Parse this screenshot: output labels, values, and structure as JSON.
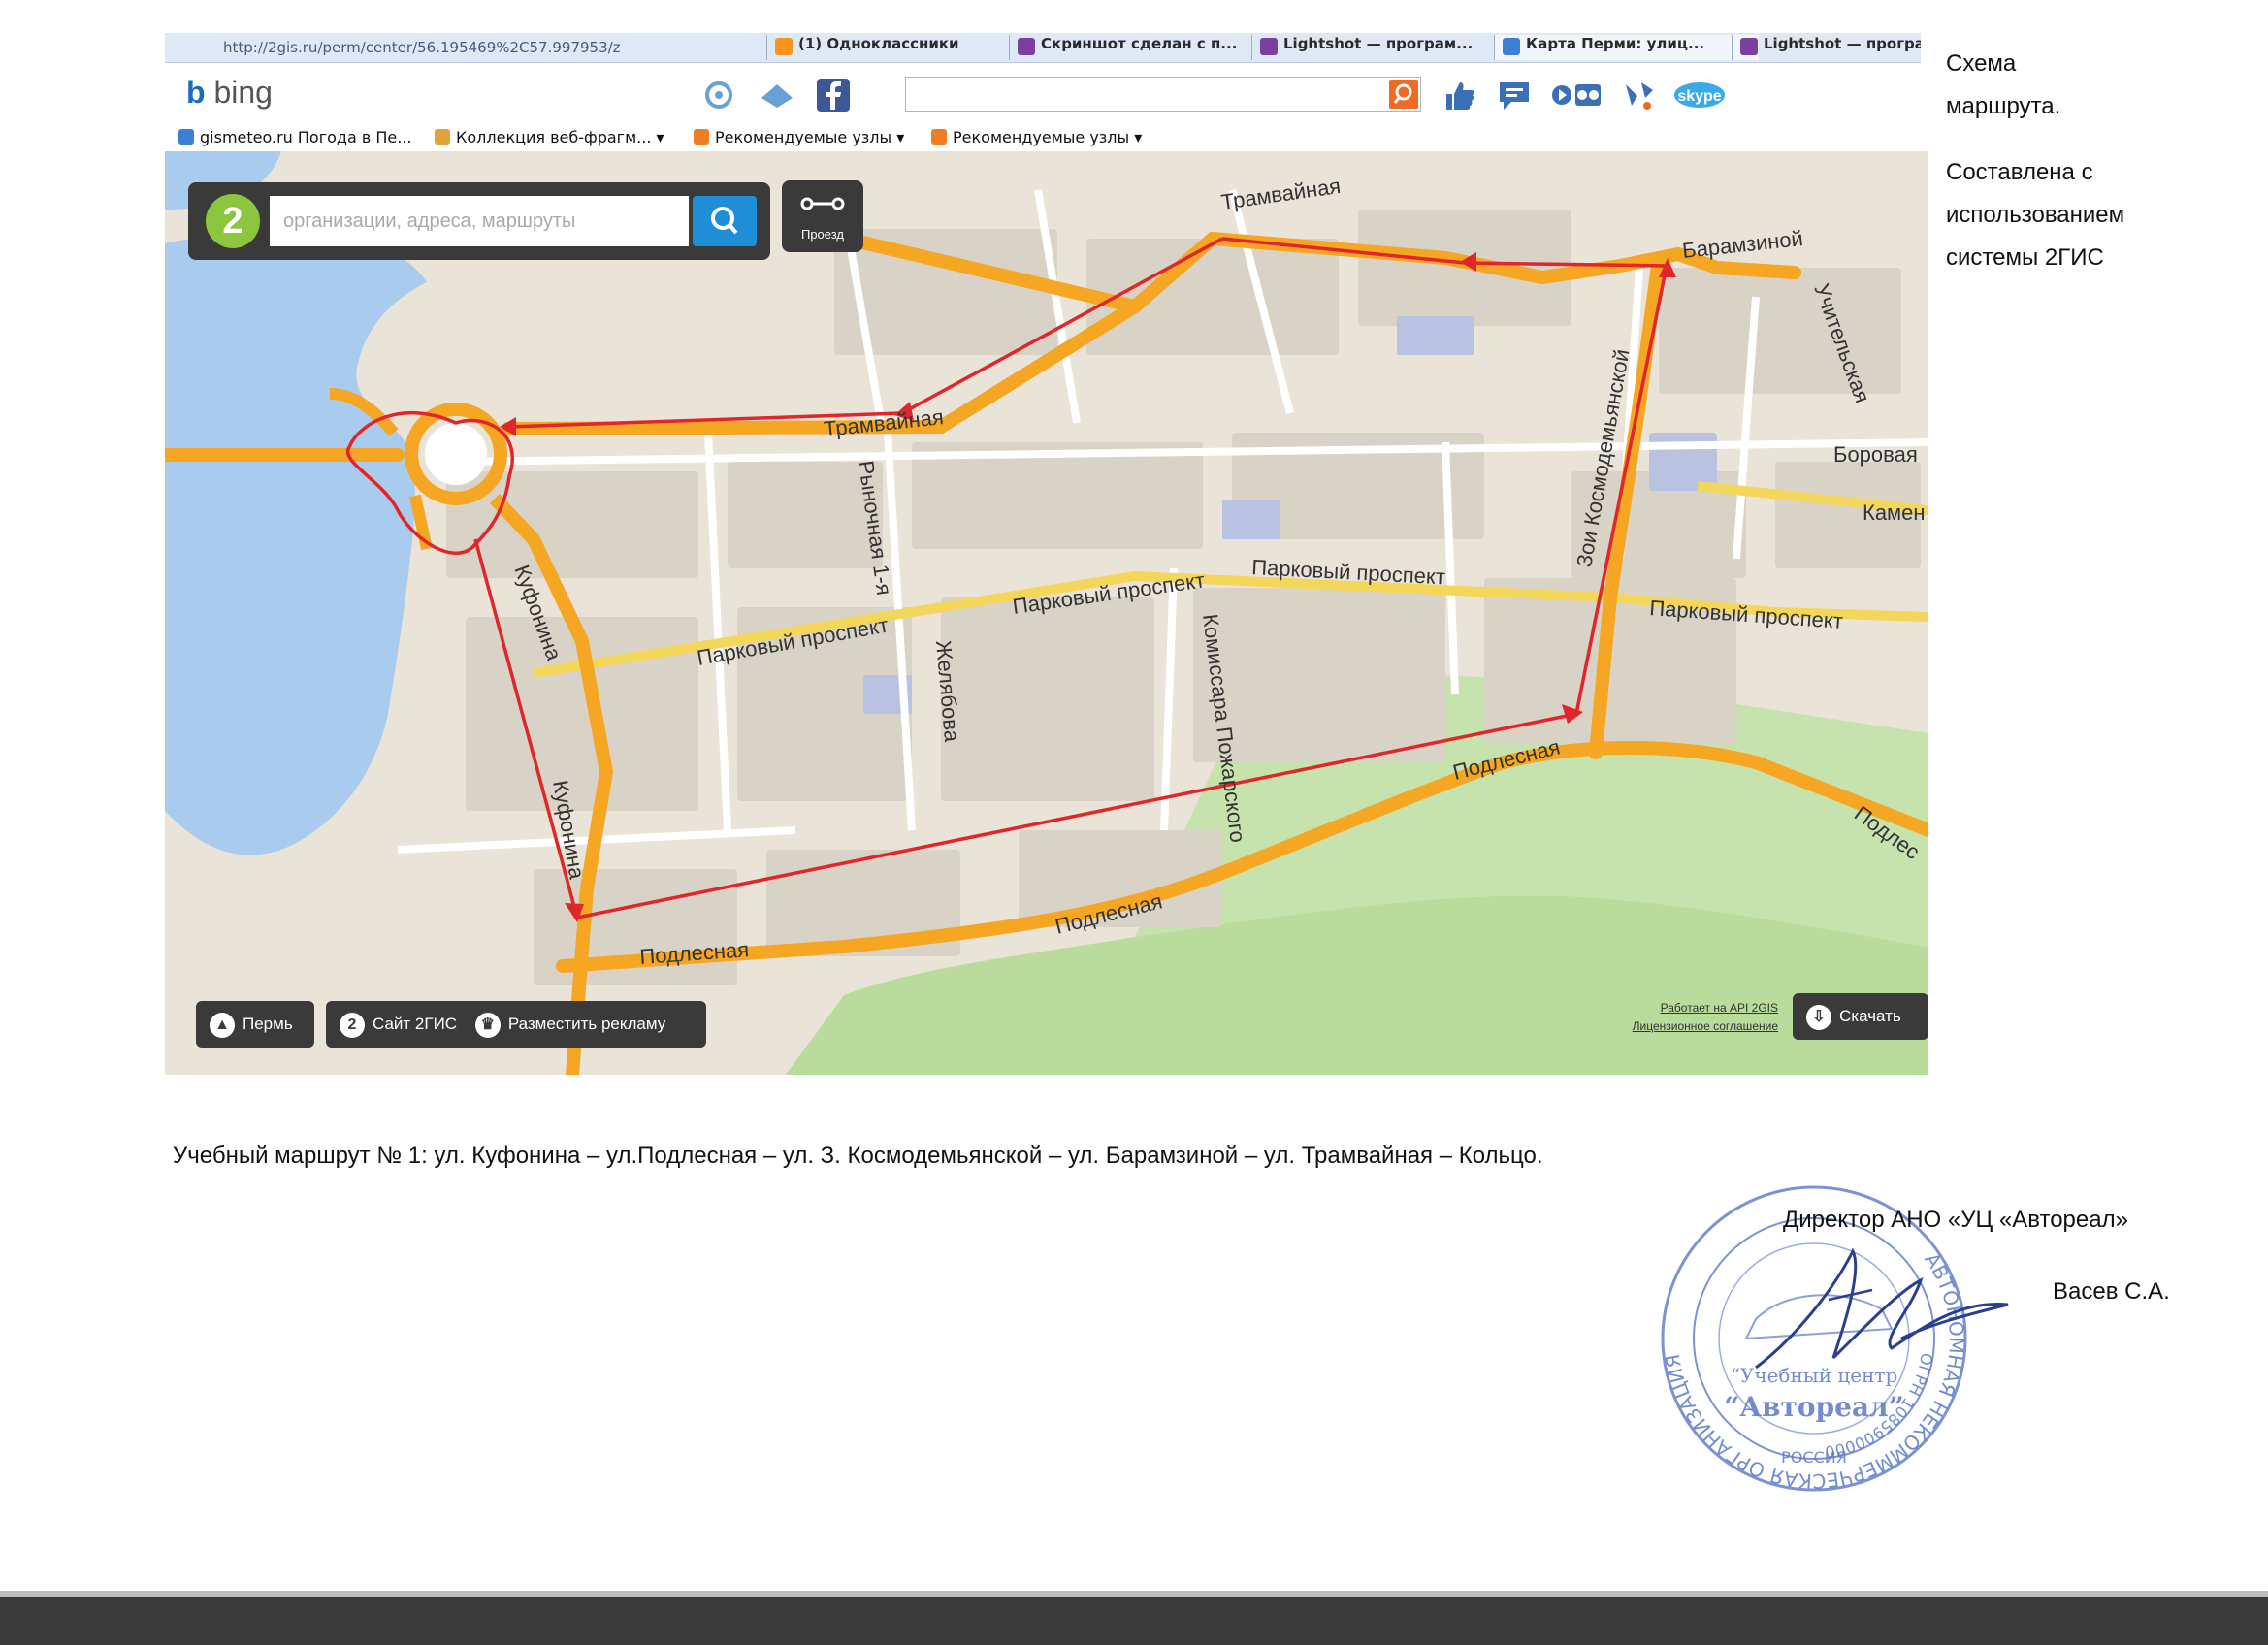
{
  "browser": {
    "address": "http://2gis.ru/perm/center/56.195469%2C57.997953/z",
    "tabs": [
      {
        "label": "(1) Одноклассники",
        "color": "#f7941d"
      },
      {
        "label": "Скриншот сделан с п...",
        "color": "#7b3fa0"
      },
      {
        "label": "Lightshot — програм...",
        "color": "#7b3fa0"
      },
      {
        "label": "Карта Перми: улиц...",
        "color": "#3b7fd6"
      },
      {
        "label": "Lightshot — програ",
        "color": "#7b3fa0"
      }
    ],
    "bing_logo": "bing",
    "favorites": [
      {
        "label": "gismeteo.ru Погода в Пе...",
        "icon": "gismeteo-icon"
      },
      {
        "label": "Коллекция веб-фрагм...",
        "icon": "webslice-icon",
        "dropdown": true
      },
      {
        "label": "Рекомендуемые узлы",
        "icon": "bing-fav-icon",
        "dropdown": true
      },
      {
        "label": "Рекомендуемые узлы",
        "icon": "bing-fav-icon",
        "dropdown": true
      }
    ]
  },
  "map": {
    "search_placeholder": "организации, адреса, маршруты",
    "route_button": "Проезд",
    "bottom_buttons": [
      {
        "label": "Пермь",
        "icon": "city-icon"
      },
      {
        "label": "Сайт 2ГИС",
        "icon": "2gis-logo-icon"
      },
      {
        "label": "Разместить рекламу",
        "icon": "crown-icon"
      }
    ],
    "api_credit": "Работает на API 2GIS",
    "license": "Лицензионное соглашение",
    "download_button": "Скачать",
    "logo_digit": "2",
    "streets": {
      "tramvaynaya_top": "Трамвайная",
      "tramvaynaya_mid": "Трамвайная",
      "baramzinoy": "Барамзиной",
      "uchitelskaya": "Учительская",
      "borovaya": "Боровая",
      "kamen": "Камен",
      "kosmodemyanskoy": "Зои Космодемьянской",
      "rynochnaya": "Рыночная 1-я",
      "parkovy_1": "Парковый проспект",
      "parkovy_2": "Парковый проспект",
      "parkovy_3": "Парковый проспект",
      "parkovy_4": "Парковый проспект",
      "zhelyabova": "Желябова",
      "komissara": "Комиссара Пожарского",
      "kufonina_1": "Куфонина",
      "kufonina_2": "Куфонина",
      "podlesnaya_1": "Подлесная",
      "podlesnaya_2": "Подлесная",
      "podlesnaya_3": "Подлесная",
      "podlesnaya_4": "Подлес"
    },
    "colors": {
      "route": "#e0262a",
      "major_road": "#f5a623",
      "park": "#b9dc9c",
      "water": "#a9cbee"
    }
  },
  "side_note": {
    "line1": "Схема",
    "line2": "маршрута.",
    "line3": "Составлена с",
    "line4": "использованием",
    "line5": "системы 2ГИС"
  },
  "caption": "Учебный маршрут № 1: ул. Куфонина – ул.Подлесная – ул. З. Космодемьянской – ул. Барамзиной  – ул. Трамвайная – Кольцо.",
  "signature": {
    "director": "Директор АНО «УЦ «Автореал»",
    "name": "Васев С.А."
  },
  "stamp": {
    "outer_text": "АВТОНОМНАЯ НЕКОММЕРЧЕСКАЯ ОРГАНИЗАЦИЯ",
    "ogrn": "ОГРН 1085900000",
    "line1": "“Учебный центр",
    "line2": "“Автореал”",
    "country": "РОССИЯ"
  }
}
